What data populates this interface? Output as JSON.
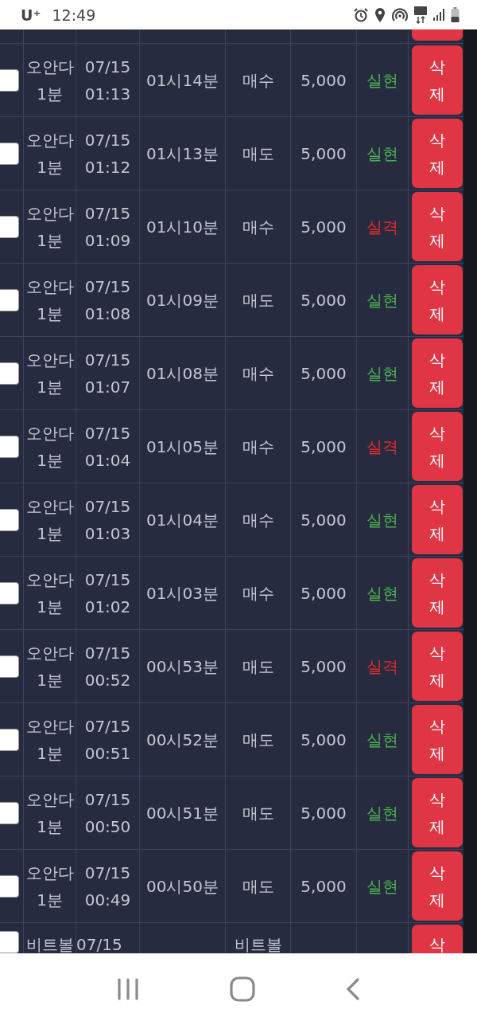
{
  "status_bar": {
    "carrier": "U⁺",
    "time": "12:49"
  },
  "rows": [
    {
      "checked": false,
      "name": "오안다 1분",
      "date": "07/15",
      "clock": "01:13",
      "round": "01시14분",
      "type": "매수",
      "amount": "5,000",
      "result": "실현",
      "color": "#4caf50",
      "action": "삭제"
    },
    {
      "checked": false,
      "name": "오안다 1분",
      "date": "07/15",
      "clock": "01:12",
      "round": "01시13분",
      "type": "매도",
      "amount": "5,000",
      "result": "실현",
      "color": "#4caf50",
      "action": "삭제"
    },
    {
      "checked": false,
      "name": "오안다 1분",
      "date": "07/15",
      "clock": "01:09",
      "round": "01시10분",
      "type": "매수",
      "amount": "5,000",
      "result": "실격",
      "color": "#e32a2a",
      "action": "삭제"
    },
    {
      "checked": false,
      "name": "오안다 1분",
      "date": "07/15",
      "clock": "01:08",
      "round": "01시09분",
      "type": "매도",
      "amount": "5,000",
      "result": "실현",
      "color": "#4caf50",
      "action": "삭제"
    },
    {
      "checked": false,
      "name": "오안다 1분",
      "date": "07/15",
      "clock": "01:07",
      "round": "01시08분",
      "type": "매수",
      "amount": "5,000",
      "result": "실현",
      "color": "#4caf50",
      "action": "삭제"
    },
    {
      "checked": false,
      "name": "오안다 1분",
      "date": "07/15",
      "clock": "01:04",
      "round": "01시05분",
      "type": "매수",
      "amount": "5,000",
      "result": "실격",
      "color": "#e32a2a",
      "action": "삭제"
    },
    {
      "checked": false,
      "name": "오안다 1분",
      "date": "07/15",
      "clock": "01:03",
      "round": "01시04분",
      "type": "매수",
      "amount": "5,000",
      "result": "실현",
      "color": "#4caf50",
      "action": "삭제"
    },
    {
      "checked": false,
      "name": "오안다 1분",
      "date": "07/15",
      "clock": "01:02",
      "round": "01시03분",
      "type": "매수",
      "amount": "5,000",
      "result": "실현",
      "color": "#4caf50",
      "action": "삭제"
    },
    {
      "checked": false,
      "name": "오안다 1분",
      "date": "07/15",
      "clock": "00:52",
      "round": "00시53분",
      "type": "매도",
      "amount": "5,000",
      "result": "실격",
      "color": "#e32a2a",
      "action": "삭제"
    },
    {
      "checked": false,
      "name": "오안다 1분",
      "date": "07/15",
      "clock": "00:51",
      "round": "00시52분",
      "type": "매도",
      "amount": "5,000",
      "result": "실현",
      "color": "#4caf50",
      "action": "삭제"
    },
    {
      "checked": false,
      "name": "오안다 1분",
      "date": "07/15",
      "clock": "00:50",
      "round": "00시51분",
      "type": "매도",
      "amount": "5,000",
      "result": "실현",
      "color": "#4caf50",
      "action": "삭제"
    },
    {
      "checked": false,
      "name": "오안다 1분",
      "date": "07/15",
      "clock": "00:49",
      "round": "00시50분",
      "type": "매도",
      "amount": "5,000",
      "result": "실현",
      "color": "#4caf50",
      "action": "삭제"
    },
    {
      "checked": false,
      "partial": true,
      "name": "비트볼",
      "date": "07/15",
      "type": "비트볼",
      "action": "삭"
    }
  ]
}
